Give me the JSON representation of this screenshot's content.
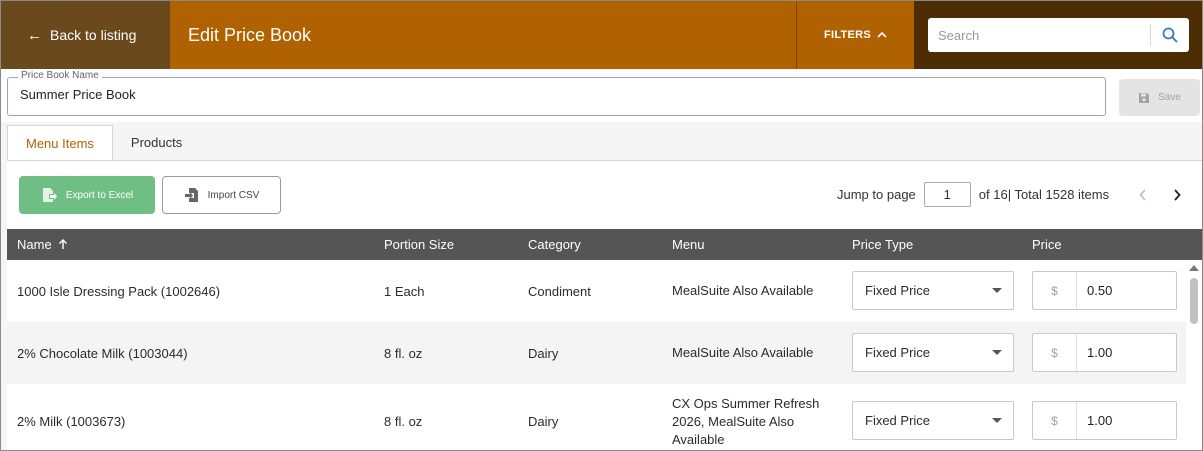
{
  "header": {
    "back_label": "Back to listing",
    "title": "Edit Price Book",
    "filters_label": "FILTERS",
    "search_placeholder": "Search"
  },
  "form": {
    "name_label": "Price Book Name",
    "name_value": "Summer Price Book",
    "save_label": "Save"
  },
  "tabs": [
    {
      "label": "Menu Items",
      "active": true
    },
    {
      "label": "Products",
      "active": false
    }
  ],
  "toolbar": {
    "export_label": "Export to Excel",
    "import_label": "Import CSV"
  },
  "pager": {
    "jump_label": "Jump to page",
    "page_value": "1",
    "summary": "of 16| Total 1528 items"
  },
  "table": {
    "columns": [
      "Name",
      "Portion Size",
      "Category",
      "Menu",
      "Price Type",
      "Price"
    ],
    "sort_column": "Name",
    "currency_symbol": "$",
    "rows": [
      {
        "name": "1000 Isle Dressing Pack (1002646)",
        "portion": "1 Each",
        "category": "Condiment",
        "menu": "MealSuite Also Available",
        "price_type": "Fixed Price",
        "price": "0.50"
      },
      {
        "name": "2% Chocolate Milk (1003044)",
        "portion": "8 fl. oz",
        "category": "Dairy",
        "menu": "MealSuite Also Available",
        "price_type": "Fixed Price",
        "price": "1.00"
      },
      {
        "name": "2% Milk (1003673)",
        "portion": "8 fl. oz",
        "category": "Dairy",
        "menu": "CX Ops Summer Refresh 2026, MealSuite Also Available",
        "price_type": "Fixed Price",
        "price": "1.00"
      }
    ]
  },
  "colors": {
    "header_bg": "#b06200",
    "back_bg": "#6a4a1d",
    "search_bg": "#4f2d04",
    "active_tab_text": "#b06200",
    "export_bg": "#6fbf84",
    "table_header_bg": "#555555",
    "search_icon": "#3a7dbf"
  }
}
